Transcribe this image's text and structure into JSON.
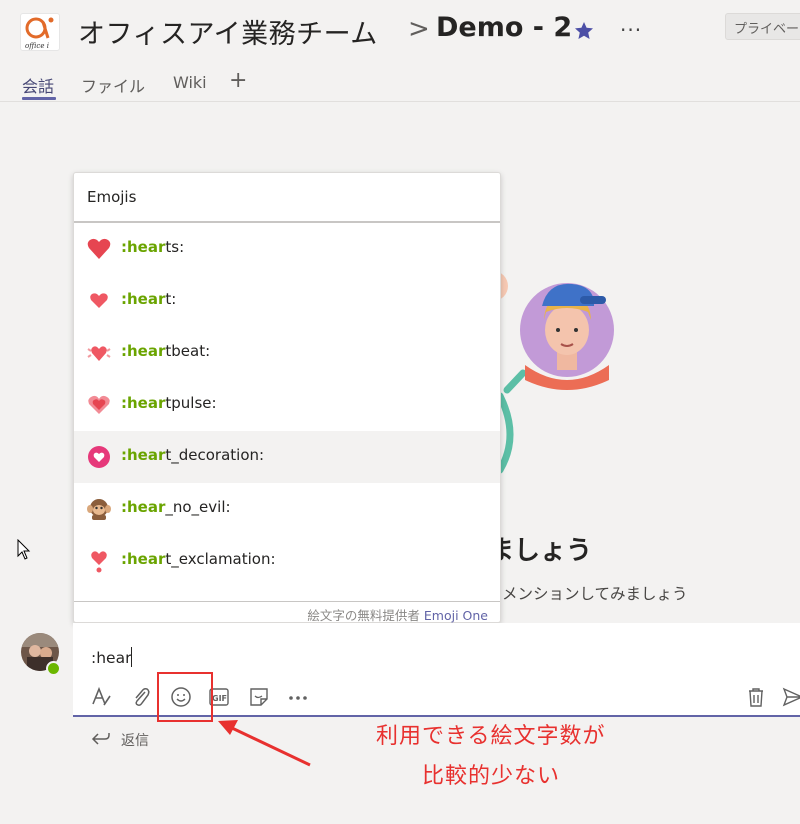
{
  "header": {
    "team_name": "オフィスアイ業務チーム",
    "breadcrumb_separator": ">",
    "channel_name": "Demo - 2",
    "more": "···",
    "privacy": "プライベー",
    "logo_text": "office i"
  },
  "tabs": [
    {
      "label": "会話",
      "active": true
    },
    {
      "label": "ファイル"
    },
    {
      "label": "Wiki"
    },
    {
      "label": "+"
    }
  ],
  "welcome": {
    "title": "ましょう",
    "subtitle": "メンションしてみましょう"
  },
  "emoji_picker": {
    "header": "Emojis",
    "items": [
      {
        "match": ":hear",
        "rest": "ts:",
        "icon": "hearts-icon"
      },
      {
        "match": ":hear",
        "rest": "t:",
        "icon": "heart-icon"
      },
      {
        "match": ":hear",
        "rest": "tbeat:",
        "icon": "heartbeat-icon"
      },
      {
        "match": ":hear",
        "rest": "tpulse:",
        "icon": "heartpulse-icon"
      },
      {
        "match": ":hear",
        "rest": "t_decoration:",
        "icon": "heart-decoration-icon",
        "selected": true
      },
      {
        "match": ":hear",
        "rest": "_no_evil:",
        "icon": "hear-no-evil-monkey-icon"
      },
      {
        "match": ":hear",
        "rest": "t_exclamation:",
        "icon": "heart-exclamation-icon"
      }
    ],
    "footer_text": "絵文字の無料提供者 ",
    "footer_link": "Emoji One"
  },
  "composer": {
    "input_value": ":hear",
    "toolbar": [
      "format-icon",
      "attach-icon",
      "emoji-icon",
      "gif-icon",
      "sticker-icon",
      "more-options-icon",
      "delete-icon",
      "send-icon"
    ],
    "gif_label": "GIF"
  },
  "reply": {
    "label": "返信"
  },
  "annotation": {
    "line1": "利用できる絵文字数が",
    "line2": "比較的少ない"
  },
  "colors": {
    "accent": "#6264a7",
    "match_green": "#6aa400",
    "annotation_red": "#e8312f",
    "presence_green": "#6bb700"
  }
}
